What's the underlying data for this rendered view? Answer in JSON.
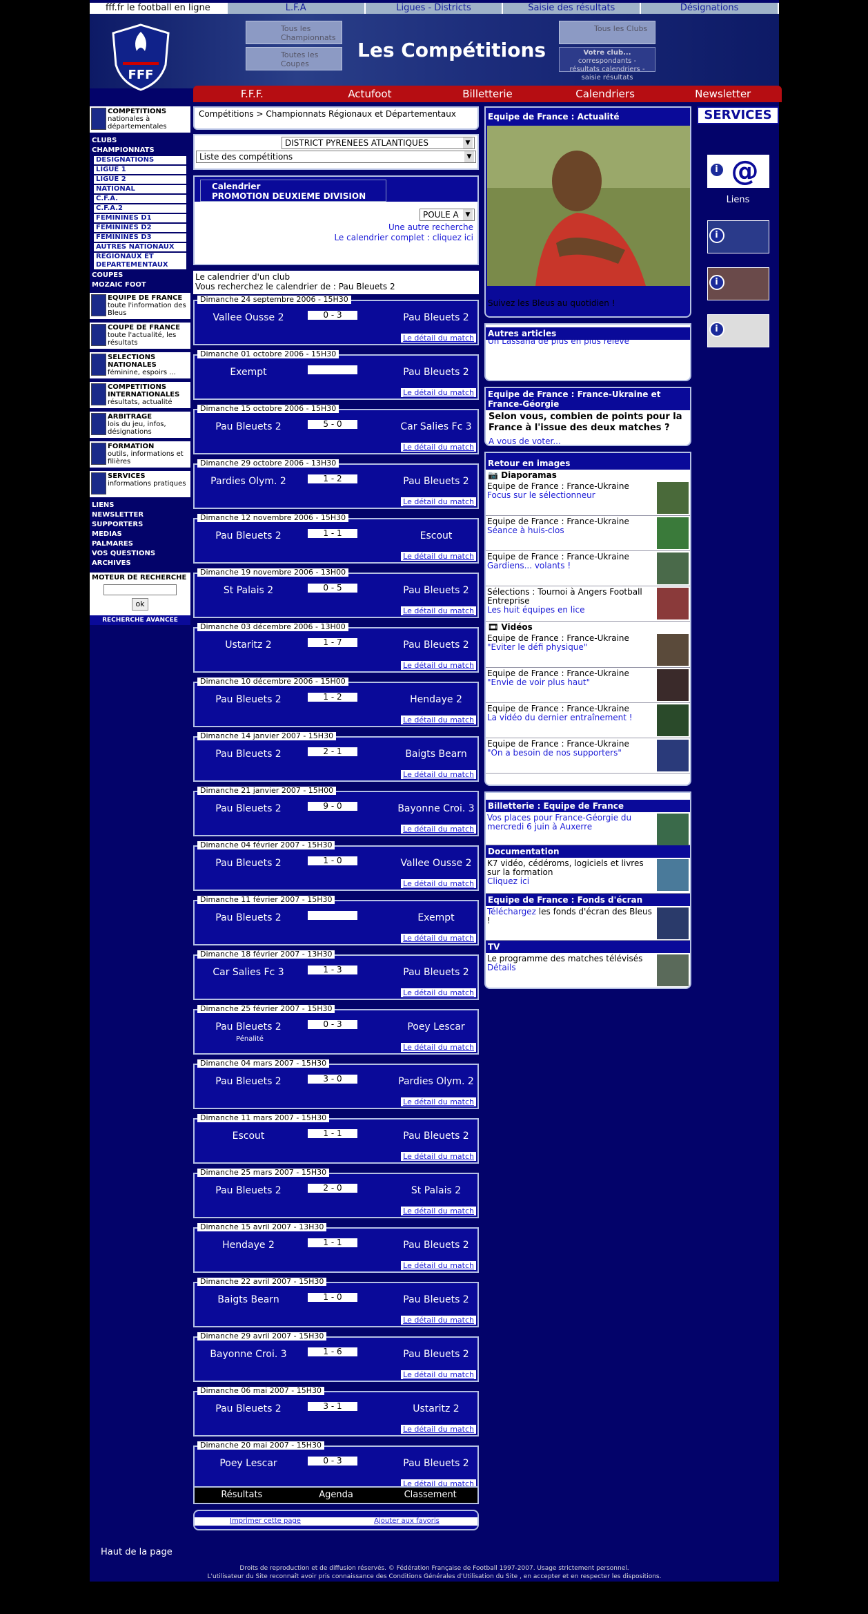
{
  "top_tabs": [
    "fff.fr le football en ligne",
    "L.F.A",
    "Ligues - Districts",
    "Saisie des résultats",
    "Désignations"
  ],
  "banner": {
    "title": "Les Compétitions",
    "thumb1": "Tous les Championnats",
    "thumb2": "Toutes les Coupes",
    "thumb3": "Tous les Clubs",
    "thumb4_title": "Votre club...",
    "thumb4_text": "correspondants - résultats calendriers - saisie résultats"
  },
  "main_nav": [
    "F.F.F.",
    "Actufoot",
    "Billetterie",
    "Calendriers",
    "Newsletter"
  ],
  "left": {
    "box_competitions": {
      "title": "COMPETITIONS",
      "text": "nationales à départementales"
    },
    "links_top": [
      "CLUBS",
      "CHAMPIONNATS"
    ],
    "championnats": [
      "DESIGNATIONS",
      "LIGUE 1",
      "LIGUE 2",
      "NATIONAL",
      "C.F.A.",
      "C.F.A.2",
      "FEMININES D1",
      "FEMININES D2",
      "FEMININES D3",
      "AUTRES NATIONAUX",
      "REGIONAUX ET DEPARTEMENTAUX"
    ],
    "links_mid": [
      "COUPES",
      "MOZAIC FOOT"
    ],
    "boxes": [
      {
        "title": "EQUIPE DE FRANCE",
        "text": "toute l'information des Bleus"
      },
      {
        "title": "COUPE DE FRANCE",
        "text": "toute l'actualité, les résultats"
      },
      {
        "title": "SELECTIONS NATIONALES",
        "text": "féminine, espoirs ..."
      },
      {
        "title": "COMPETITIONS INTERNATIONALES",
        "text": "résultats, actualité"
      },
      {
        "title": "ARBITRAGE",
        "text": "lois du jeu, infos, désignations"
      },
      {
        "title": "FORMATION",
        "text": "outils, informations et filières"
      },
      {
        "title": "SERVICES",
        "text": "informations pratiques"
      }
    ],
    "links_bottom": [
      "LIENS",
      "NEWSLETTER",
      "SUPPORTERS",
      "MEDIAS",
      "PALMARES",
      "VOS QUESTIONS",
      "ARCHIVES"
    ],
    "search_title": "MOTEUR DE RECHERCHE",
    "search_button": "ok",
    "advanced": "RECHERCHE AVANCEE",
    "haut": "Haut de la page"
  },
  "mid": {
    "breadcrumb": "Compétitions > Championnats Régionaux et Départementaux",
    "district": "DISTRICT PYRENEES ATLANTIQUES",
    "liste": "Liste des compétitions",
    "cal_title1": "Calendrier",
    "cal_title2": "PROMOTION DEUXIEME DIVISION",
    "poule": "POULE A",
    "autre": "Une autre recherche",
    "complet": "Le calendrier complet : cliquez ici",
    "club_line1": "Le calendrier d'un club",
    "club_line2": "Vous recherchez le calendrier de : Pau Bleuets 2",
    "detail": "Le détail du match",
    "matches": [
      {
        "date": "Dimanche 24 septembre 2006 - 15H30",
        "home": "Vallee Ousse 2",
        "score": "0 - 3",
        "away": "Pau Bleuets 2",
        "note": ""
      },
      {
        "date": "Dimanche 01 octobre 2006 - 15H30",
        "home": "Exempt",
        "score": "",
        "away": "Pau Bleuets 2",
        "note": ""
      },
      {
        "date": "Dimanche 15 octobre 2006 - 15H30",
        "home": "Pau Bleuets 2",
        "score": "5 - 0",
        "away": "Car Salies Fc 3",
        "note": ""
      },
      {
        "date": "Dimanche 29 octobre 2006 - 13H30",
        "home": "Pardies Olym. 2",
        "score": "1 - 2",
        "away": "Pau Bleuets 2",
        "note": ""
      },
      {
        "date": "Dimanche 12 novembre 2006 - 15H30",
        "home": "Pau Bleuets 2",
        "score": "1 - 1",
        "away": "Escout",
        "note": ""
      },
      {
        "date": "Dimanche 19 novembre 2006 - 13H00",
        "home": "St Palais 2",
        "score": "0 - 5",
        "away": "Pau Bleuets 2",
        "note": ""
      },
      {
        "date": "Dimanche 03 décembre 2006 - 13H00",
        "home": "Ustaritz 2",
        "score": "1 - 7",
        "away": "Pau Bleuets 2",
        "note": ""
      },
      {
        "date": "Dimanche 10 décembre 2006 - 15H00",
        "home": "Pau Bleuets 2",
        "score": "1 - 2",
        "away": "Hendaye 2",
        "note": ""
      },
      {
        "date": "Dimanche 14 janvier 2007 - 15H30",
        "home": "Pau Bleuets 2",
        "score": "2 - 1",
        "away": "Baigts Bearn",
        "note": ""
      },
      {
        "date": "Dimanche 21 janvier 2007 - 15H00",
        "home": "Pau Bleuets 2",
        "score": "9 - 0",
        "away": "Bayonne Croi. 3",
        "note": ""
      },
      {
        "date": "Dimanche 04 février 2007 - 15H30",
        "home": "Pau Bleuets 2",
        "score": "1 - 0",
        "away": "Vallee Ousse 2",
        "note": ""
      },
      {
        "date": "Dimanche 11 février 2007 - 15H30",
        "home": "Pau Bleuets 2",
        "score": "",
        "away": "Exempt",
        "note": ""
      },
      {
        "date": "Dimanche 18 février 2007 - 13H30",
        "home": "Car Salies Fc 3",
        "score": "1 - 3",
        "away": "Pau Bleuets 2",
        "note": ""
      },
      {
        "date": "Dimanche 25 février 2007 - 15H30",
        "home": "Pau Bleuets 2",
        "score": "0 - 3",
        "away": "Poey Lescar",
        "note": "Pénalité"
      },
      {
        "date": "Dimanche 04 mars 2007 - 15H30",
        "home": "Pau Bleuets 2",
        "score": "3 - 0",
        "away": "Pardies Olym. 2",
        "note": ""
      },
      {
        "date": "Dimanche 11 mars 2007 - 15H30",
        "home": "Escout",
        "score": "1 - 1",
        "away": "Pau Bleuets 2",
        "note": ""
      },
      {
        "date": "Dimanche 25 mars 2007 - 15H30",
        "home": "Pau Bleuets 2",
        "score": "2 - 0",
        "away": "St Palais 2",
        "note": ""
      },
      {
        "date": "Dimanche 15 avril 2007 - 13H30",
        "home": "Hendaye 2",
        "score": "1 - 1",
        "away": "Pau Bleuets 2",
        "note": ""
      },
      {
        "date": "Dimanche 22 avril 2007 - 15H30",
        "home": "Baigts Bearn",
        "score": "1 - 0",
        "away": "Pau Bleuets 2",
        "note": ""
      },
      {
        "date": "Dimanche 29 avril 2007 - 15H30",
        "home": "Bayonne Croi. 3",
        "score": "1 - 6",
        "away": "Pau Bleuets 2",
        "note": ""
      },
      {
        "date": "Dimanche 06 mai 2007 - 15H30",
        "home": "Pau Bleuets 2",
        "score": "3 - 1",
        "away": "Ustaritz 2",
        "note": ""
      },
      {
        "date": "Dimanche 20 mai 2007 - 15H30",
        "home": "Poey Lescar",
        "score": "0 - 3",
        "away": "Pau Bleuets 2",
        "note": ""
      }
    ],
    "bottom_tabs": [
      "Résultats",
      "Agenda",
      "Classement"
    ],
    "print": "Imprimer cette page",
    "fav": "Ajouter aux favoris"
  },
  "right": {
    "actu_title": "Equipe de France : Actualité",
    "actu_caption": "Suivez les Bleus au quotidien !",
    "autres_title": "Autres articles",
    "autres_text": "Un Lassana de plus en plus relevé",
    "vote_title": "Equipe de France : France-Ukraine et France-Géorgie",
    "vote_q": "Selon vous, combien de points pour la France à l'issue des deux matches ?",
    "vote_link": "A vous de voter...",
    "retour_title": "Retour en images",
    "diaporamas": "Diaporamas",
    "videos": "Vidéos",
    "diapo_items": [
      {
        "t": "Equipe de France : France-Ukraine",
        "l": "Focus sur le sélectionneur"
      },
      {
        "t": "Equipe de France : France-Ukraine",
        "l": "Séance à huis-clos"
      },
      {
        "t": "Equipe de France : France-Ukraine",
        "l": "Gardiens... volants !"
      },
      {
        "t": "Sélections : Tournoi à Angers Football Entreprise",
        "l": "Les huit équipes en lice"
      }
    ],
    "video_items": [
      {
        "t": "Equipe de France : France-Ukraine",
        "l": "\"Eviter le défi physique\""
      },
      {
        "t": "Equipe de France : France-Ukraine",
        "l": "\"Envie de voir plus haut\""
      },
      {
        "t": "Equipe de France : France-Ukraine",
        "l": "La vidéo du dernier entraînement !"
      },
      {
        "t": "Equipe de France : France-Ukraine",
        "l": "\"On a besoin de nos supporters\""
      }
    ],
    "bil_title": "Billetterie : Equipe de France",
    "bil_text": "Vos places pour France-Géorgie du mercredi 6 juin à Auxerre",
    "doc_title": "Documentation",
    "doc_text": "K7 vidéo, cédéroms, logiciels et livres sur la formation",
    "doc_link": "Cliquez ici",
    "fond_title": "Equipe de France : Fonds d'écran",
    "fond_link": "Téléchargez",
    "fond_text": " les fonds d'écran des Bleus !",
    "tv_title": "TV",
    "tv_text": "Le programme des matches télévisés",
    "tv_link": "Détails"
  },
  "services": {
    "title": "SERVICES",
    "liens": "Liens"
  },
  "footer": {
    "line1": "Droits de reproduction et de diffusion réservés. © Fédération Française de Football 1997-2007. Usage strictement personnel.",
    "line2": "L'utilisateur du Site reconnaît avoir pris connaissance des Conditions Générales d'Utilisation du Site , en accepter et en respecter les dispositions."
  }
}
